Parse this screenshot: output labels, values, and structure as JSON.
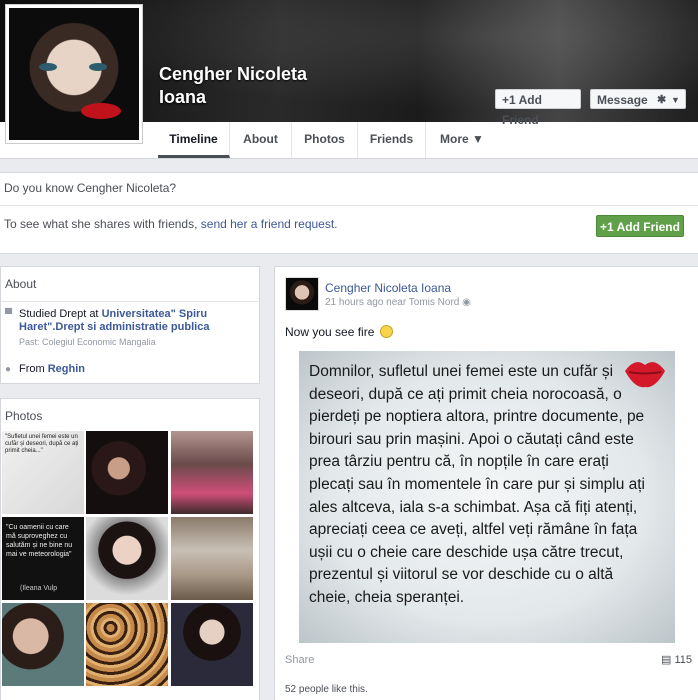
{
  "profile": {
    "name_line1": "Cengher Nicoleta",
    "name_line2": "Ioana",
    "add_friend": "Add Friend",
    "message": "Message",
    "gear_icon": "gear-icon",
    "caret_icon": "caret-down-icon"
  },
  "nav": {
    "tabs": [
      {
        "label": "Timeline",
        "active": true
      },
      {
        "label": "About"
      },
      {
        "label": "Photos"
      },
      {
        "label": "Friends"
      },
      {
        "label": "More ▼"
      }
    ]
  },
  "know": {
    "question": "Do you know Cengher Nicoleta?",
    "text_prefix": "To see what she shares with friends, ",
    "link": "send her a friend request.",
    "button": "Add Friend"
  },
  "about": {
    "title": "About",
    "studied_prefix": "Studied Drept at ",
    "studied_school": "Universitatea\" Spiru Haret\".Drept si administratie publica",
    "past": "Past: Colegiul Economic Mangalia",
    "from_prefix": "From ",
    "from_place": "Reghin"
  },
  "photos": {
    "title": "Photos",
    "thumb_quote1": "\"Sufletul unei femei este un cufăr și deseori, după ce ați primit cheia...\"",
    "thumb_quote2": "\"Cu oamenii cu care mă suproveghez cu salutăm și ne bine nu mai ve meteorologia\"",
    "thumb_quote2_author": "(Ileana Vulp"
  },
  "post": {
    "author": "Cengher Nicoleta Ioana",
    "meta": "21 hours ago near Tomis Nord",
    "globe_icon": "globe-icon",
    "text": "Now you see fire",
    "smiley_icon": "smiley-icon",
    "quote": "Domnilor, sufletul unei femei este un cufăr și deseori, după ce ați primit cheia norocoasă, o pierdeți pe noptiera altora, printre documente, pe birouri sau prin mașini. Apoi o căutați când este prea târziu pentru că, în nopțile în care erați plecați sau în momentele în care pur și simplu ați ales altceva, iala s-a schimbat. Așa că fiți atenți, apreciați ceea ce aveți, altfel veți rămâne în fața ușii cu o cheie care deschide ușa către trecut, prezentul și viitorul se vor deschide cu o altă cheie, cheia speranței.",
    "share": "Share",
    "comments": "115",
    "likes": "52 people like this."
  },
  "colors": {
    "link": "#3b5998",
    "green_button": "#5fa048",
    "lips": "#c0121b"
  }
}
